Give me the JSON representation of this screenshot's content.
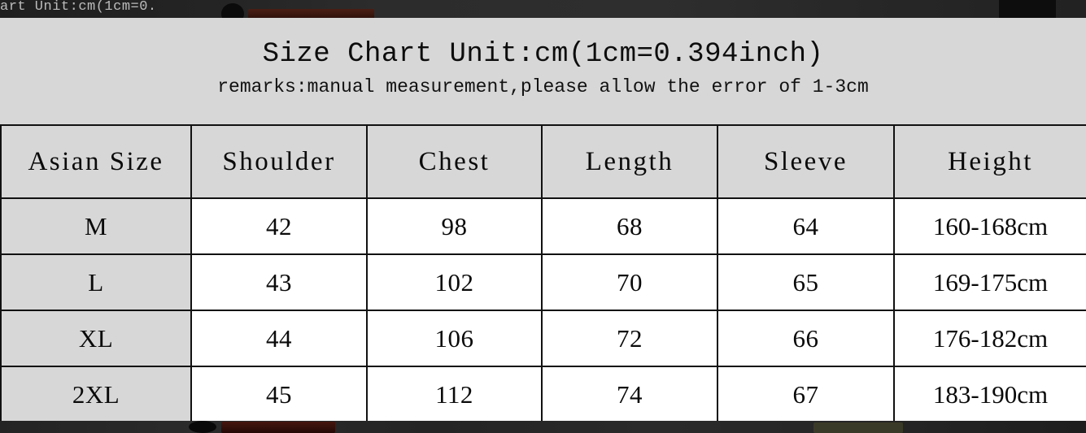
{
  "background": {
    "page_bg_color": "#d6d6d6",
    "strip_color": "#262626",
    "top_strip_text": "art Unit:cm(1cm=0."
  },
  "header": {
    "title": "Size Chart Unit:cm(1cm=0.394inch)",
    "remarks": "remarks:manual measurement,please allow the error of 1-3cm"
  },
  "table": {
    "columns": [
      "Asian Size",
      "Shoulder",
      "Chest",
      "Length",
      "Sleeve",
      "Height"
    ],
    "rows": [
      {
        "size": "M",
        "shoulder": "42",
        "chest": "98",
        "length": "68",
        "sleeve": "64",
        "height": "160-168cm"
      },
      {
        "size": "L",
        "shoulder": "43",
        "chest": "102",
        "length": "70",
        "sleeve": "65",
        "height": "169-175cm"
      },
      {
        "size": "XL",
        "shoulder": "44",
        "chest": "106",
        "length": "72",
        "sleeve": "66",
        "height": "176-182cm"
      },
      {
        "size": "2XL",
        "shoulder": "45",
        "chest": "112",
        "length": "74",
        "sleeve": "67",
        "height": "183-190cm"
      }
    ]
  },
  "colors": {
    "header_cell_bg": "#d7d7d7",
    "data_cell_bg": "#ffffff",
    "size_cell_bg": "#d7d7d7",
    "border": "#111111",
    "text": "#0a0a0a"
  }
}
